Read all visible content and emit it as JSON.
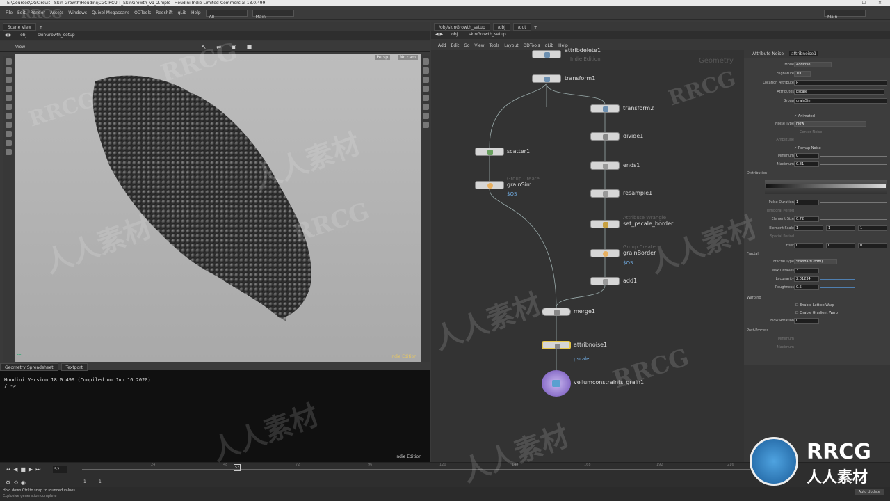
{
  "window": {
    "title": "E:\\Courses\\CGCircuit - Skin Growth\\Houdini\\CGCIRCUIT_SkinGrowth_v1_2.hiplc - Houdini Indie Limited-Commercial 18.0.499"
  },
  "menu": {
    "items": [
      "File",
      "Edit",
      "Render",
      "Assets",
      "Windows",
      "Quixel Megascans",
      "ODTools",
      "Redshift",
      "qLib",
      "Help"
    ],
    "desktop": "All",
    "build": "Main",
    "right_build": "Main"
  },
  "scene": {
    "pane_label": "Scene View",
    "context": "obj",
    "node_path": "skinGrowth_setup",
    "view_label": "View",
    "persp": "Persp",
    "cam": "No cam",
    "edition": "Indie Edition"
  },
  "sheet": {
    "tabs": [
      "Geometry Spreadsheet",
      "Textport"
    ],
    "lines": [
      "Houdini Version 18.0.499 (Compiled on Jun 16 2020)",
      "/ ->"
    ],
    "edition": "Indie Edition"
  },
  "network": {
    "tabs": [
      "/obj/skinGrowth_setup",
      "/obj",
      "/out"
    ],
    "context": "obj",
    "node_path": "skinGrowth_setup",
    "menu": [
      "Add",
      "Edit",
      "Go",
      "View",
      "Tools",
      "Layout",
      "ODTools",
      "qLib",
      "Help"
    ],
    "watermark_label": "Geometry",
    "nodes": {
      "attribdelete": "attribdelete1",
      "indie": "Indie Edition",
      "transform1": "transform1",
      "transform2": "transform2",
      "divide1": "divide1",
      "ends1": "ends1",
      "resample1": "resample1",
      "set_pscale_sub": "Attribute Wrangle",
      "set_pscale": "set_pscale_border",
      "grainborder_sub": "Group Create",
      "grainborder": "grainBorder",
      "grainborder_os": "$OS",
      "add1": "add1",
      "scatter1": "scatter1",
      "grainsim_sub": "Group Create",
      "grainsim": "grainSim",
      "grainsim_os": "$OS",
      "merge1": "merge1",
      "attribnoise1": "attribnoise1",
      "attribnoise_attr": "pscale",
      "vellum": "vellumconstraints_grain1"
    }
  },
  "params": {
    "type": "Attribute Noise",
    "name": "attribnoise1",
    "rows": [
      {
        "label": "Mode",
        "value": "Additive"
      },
      {
        "label": "Signature",
        "value": "1D"
      },
      {
        "label": "Location Attribute",
        "value": "P"
      },
      {
        "label": "Attributes",
        "value": "pscale"
      },
      {
        "label": "Group",
        "value": "grainSim"
      }
    ],
    "animated": "Animated",
    "noise_type_label": "Noise Type",
    "noise_type": "Flow",
    "center_noise": "Center Noise",
    "amplitude": "Amplitude",
    "remap": "Remap Noise",
    "minimum_label": "Minimum",
    "minimum": "0",
    "maximum_label": "Maximum",
    "maximum": "0.81",
    "distribution": "Distribution",
    "pulse_label": "Pulse Duration",
    "pulse": "1",
    "temporal": "Temporal Period",
    "element_size_label": "Element Size",
    "element_size": "0.72",
    "element_scale_label": "Element Scale",
    "element_scale": [
      "1",
      "1",
      "1"
    ],
    "spatial": "Spatial Period",
    "offset_label": "Offset",
    "offset": [
      "0",
      "0",
      "0"
    ],
    "fractal": "Fractal",
    "fractal_type_label": "Fractal Type",
    "fractal_type": "Standard (fBm)",
    "max_oct_label": "Max Octaves",
    "max_oct": "3",
    "lac_label": "Lacunarity",
    "lac": "2.01234",
    "rough_label": "Roughness",
    "rough": "0.5",
    "warping": "Warping",
    "lattice": "Enable Lattice Warp",
    "gradient": "Enable Gradient Warp",
    "flow_label": "Flow Rotation",
    "flow": "0",
    "post": "Post-Process",
    "post_min": "Minimum",
    "post_max": "Maximum"
  },
  "timeline": {
    "frame": "52",
    "start": "1",
    "start2": "1",
    "ticks": [
      "24",
      "48",
      "72",
      "96",
      "120",
      "144",
      "168",
      "192",
      "216",
      "240"
    ],
    "end": "240",
    "keys": "Key All Channels",
    "auto_update": "Auto Update"
  },
  "status": {
    "line1": "Hold down Ctrl to snap to rounded values",
    "line2": "Explosive generation complete"
  },
  "watermarks": {
    "rrcg": "RRCG",
    "cn": "人人素材"
  }
}
